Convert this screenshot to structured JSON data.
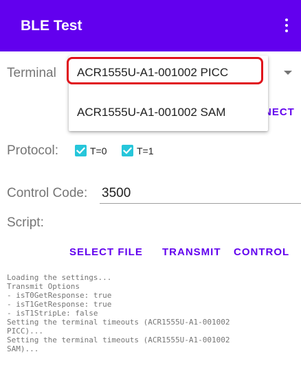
{
  "app": {
    "title": "BLE Test"
  },
  "terminal": {
    "label": "Terminal",
    "dropdown_options": [
      "ACR1555U-A1-001002 PICC",
      "ACR1555U-A1-001002 SAM"
    ],
    "selected_index": 0
  },
  "connect_button": "NECT",
  "protocol": {
    "label": "Protocol:",
    "options": [
      {
        "label": "T=0",
        "checked": true
      },
      {
        "label": "T=1",
        "checked": true
      }
    ]
  },
  "control_code": {
    "label": "Control Code:",
    "value": "3500"
  },
  "script": {
    "label": "Script:"
  },
  "actions": {
    "select_file": "SELECT FILE",
    "transmit": "TRANSMIT",
    "control": "CONTROL"
  },
  "log_lines": [
    "Loading the settings...",
    "Transmit Options",
    "- isT0GetResponse: true",
    "- isT1GetResponse: true",
    "- isT1StripLe: false",
    "Setting the terminal timeouts (ACR1555U-A1-001002",
    "PICC)...",
    "Setting the terminal timeouts (ACR1555U-A1-001002",
    "SAM)..."
  ],
  "colors": {
    "primary": "#6200ee",
    "checkbox": "#26c6da",
    "highlight": "#e0121b"
  },
  "icons": {
    "overflow": "overflow-menu-icon",
    "dropdown": "dropdown-arrow-icon",
    "check": "check-icon"
  }
}
